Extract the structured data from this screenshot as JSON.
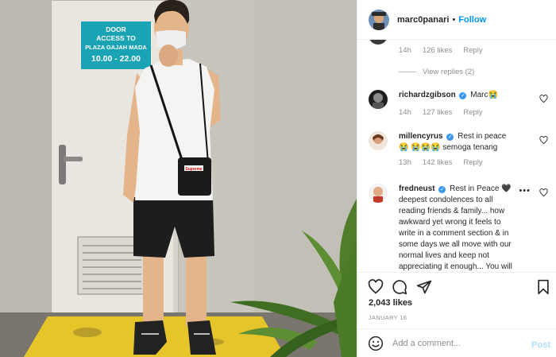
{
  "post": {
    "author": "marc0panari",
    "follow_label": "Follow",
    "dot": "•",
    "likes": "2,043 likes",
    "date": "JANUARY 16"
  },
  "photo": {
    "sign_lines": [
      "DOOR",
      "ACCESS TO",
      "PLAZA GAJAH MADA",
      "10.00 - 22.00"
    ],
    "bag_logo": "Supreme"
  },
  "comments": [
    {
      "user": "",
      "text": "",
      "time": "14h",
      "likes": "126 likes",
      "reply": "Reply",
      "view_replies": "View replies (2)"
    },
    {
      "user": "richardzgibson",
      "verified": true,
      "text": "Marc😭",
      "time": "14h",
      "likes": "127 likes",
      "reply": "Reply"
    },
    {
      "user": "millencyrus",
      "verified": true,
      "text": "Rest in peace 😭 😭😭😭 semoga tenang",
      "time": "13h",
      "likes": "142 likes",
      "reply": "Reply"
    },
    {
      "user": "fredneust",
      "verified": true,
      "text": "Rest in Peace 🖤 deepest condolences to all reading friends & family... how awkward yet wrong it feels to write in a comment section & in some days we all move with our normal lives and keep not appreciating it enough... You will"
    }
  ],
  "comment_box": {
    "placeholder": "Add a comment...",
    "post_label": "Post"
  },
  "icons": {
    "like": "heart-icon",
    "comment": "comment-icon",
    "share": "paper-plane-icon",
    "save": "bookmark-icon",
    "emoji": "smiley-icon",
    "more": "more-dots-icon",
    "verified": "verified-badge-icon"
  },
  "colors": {
    "link": "#0095f6",
    "verified": "#3897f0",
    "muted": "#8e8e8e",
    "sign": "#1aa3b5",
    "floor": "#e6c52a"
  }
}
